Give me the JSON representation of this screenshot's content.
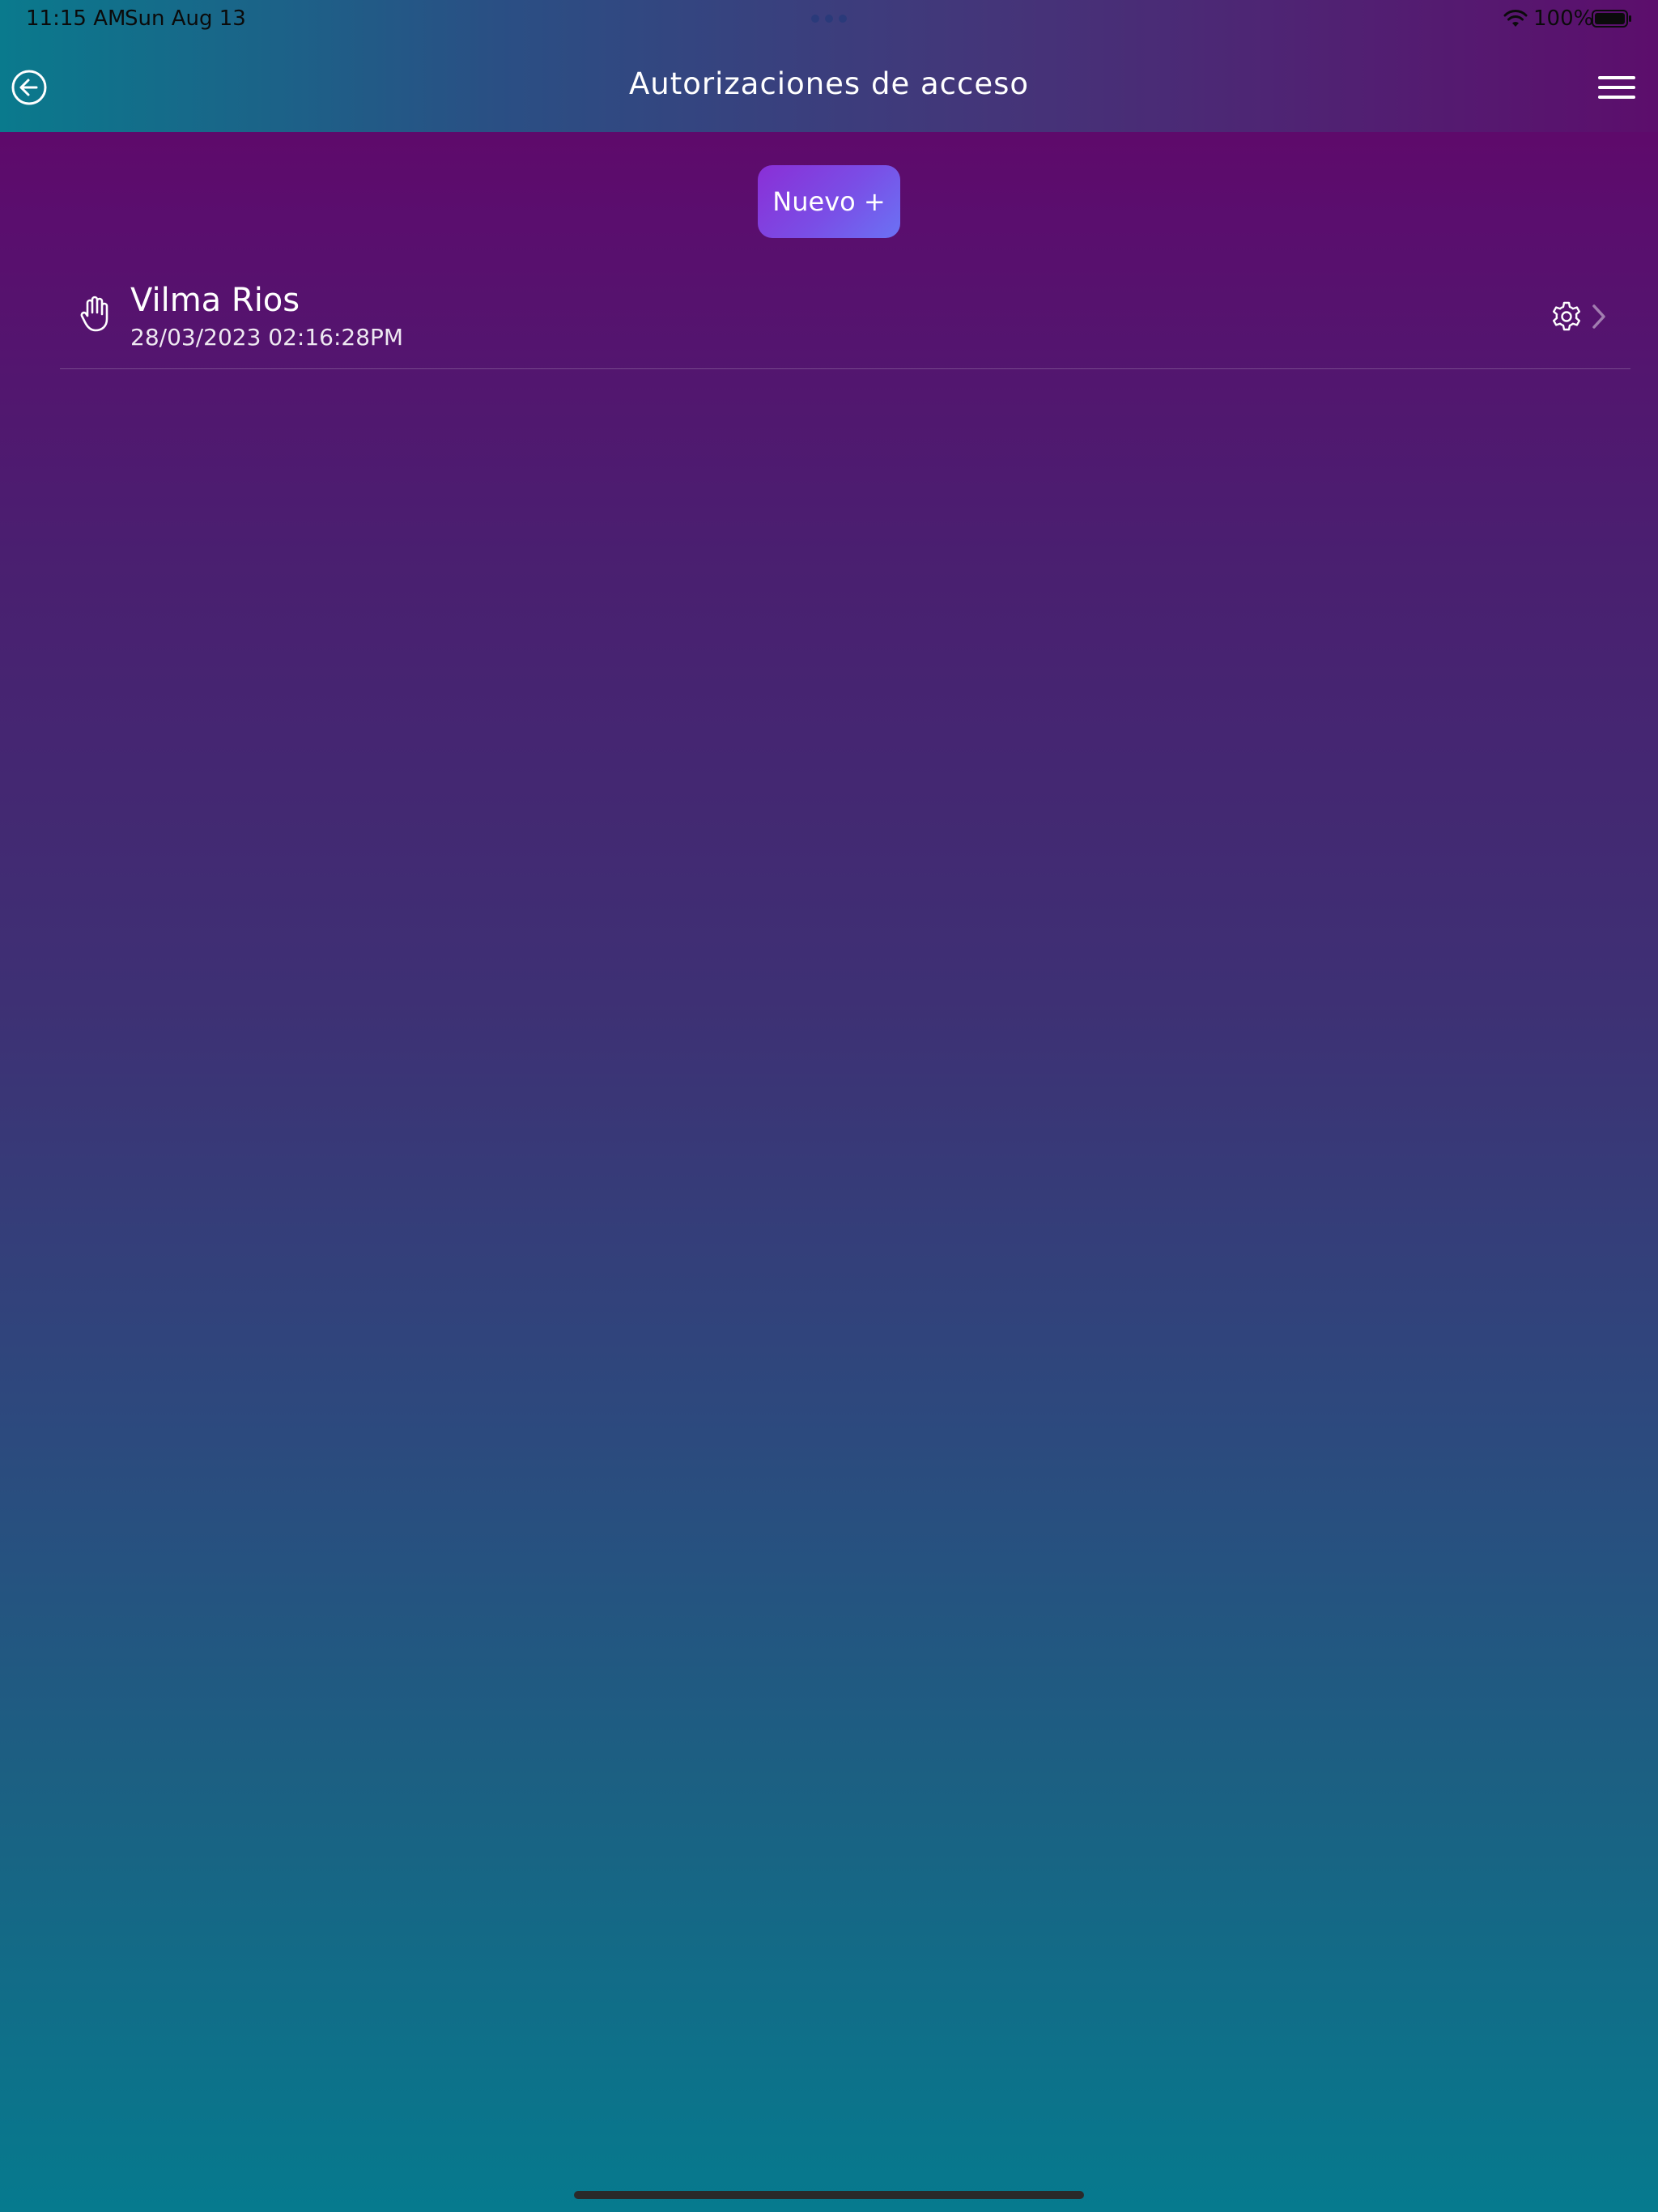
{
  "status_bar": {
    "time": "11:15 AM",
    "date": "Sun Aug 13",
    "battery": "100%",
    "wifi_icon": "wifi-icon",
    "battery_icon": "battery-icon"
  },
  "nav": {
    "title": "Autorizaciones de acceso",
    "back_icon": "back-arrow-circle-icon",
    "menu_icon": "hamburger-menu-icon"
  },
  "actions": {
    "new_label": "Nuevo +"
  },
  "list": {
    "items": [
      {
        "name": "Vilma Rios",
        "date": "28/03/2023 02:16:28PM",
        "leading_icon": "hand-icon",
        "trailing_icon": "gear-icon"
      }
    ]
  },
  "colors": {
    "accent_button_start": "#8a2fd6",
    "accent_button_end": "#6b72f4",
    "background_top": "#650466",
    "background_bottom": "#067a8e"
  }
}
